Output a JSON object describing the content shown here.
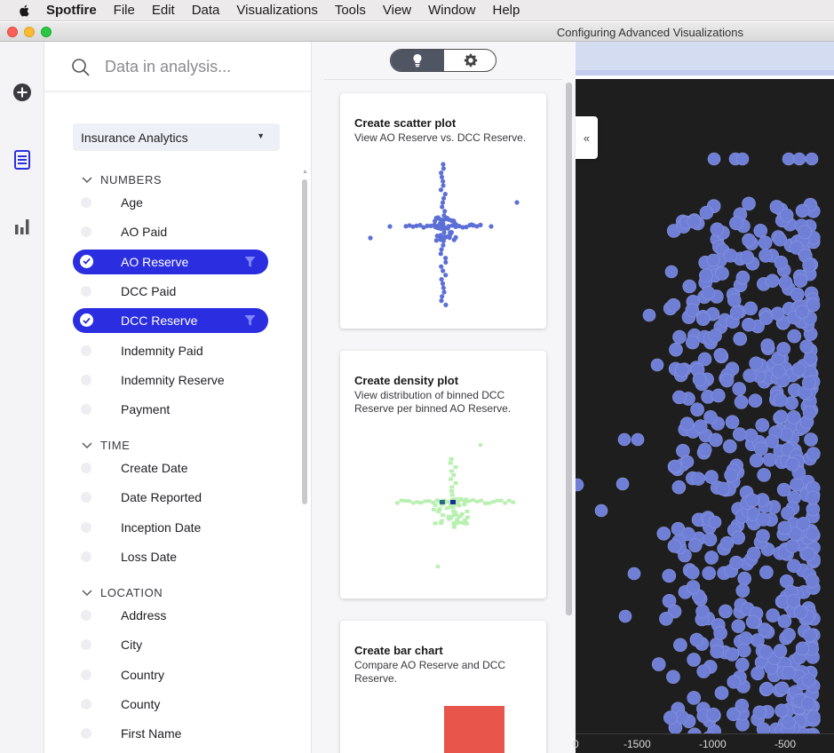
{
  "menubar": {
    "app_name": "Spotfire",
    "items": [
      "File",
      "Edit",
      "Data",
      "Visualizations",
      "Tools",
      "View",
      "Window",
      "Help"
    ]
  },
  "window": {
    "title": "Configuring Advanced Visualizations"
  },
  "rail": {
    "icons": [
      "add-icon",
      "data-panel-icon",
      "visualizations-icon"
    ]
  },
  "data_panel": {
    "search_placeholder": "Data in analysis...",
    "data_source": "Insurance Analytics",
    "sections": [
      {
        "name": "NUMBERS",
        "fields": [
          {
            "label": "Age",
            "selected": false
          },
          {
            "label": "AO Paid",
            "selected": false
          },
          {
            "label": "AO Reserve",
            "selected": true
          },
          {
            "label": "DCC Paid",
            "selected": false
          },
          {
            "label": "DCC Reserve",
            "selected": true
          },
          {
            "label": "Indemnity Paid",
            "selected": false
          },
          {
            "label": "Indemnity Reserve",
            "selected": false
          },
          {
            "label": "Payment",
            "selected": false
          }
        ]
      },
      {
        "name": "TIME",
        "fields": [
          {
            "label": "Create Date",
            "selected": false
          },
          {
            "label": "Date Reported",
            "selected": false
          },
          {
            "label": "Inception Date",
            "selected": false
          },
          {
            "label": "Loss Date",
            "selected": false
          }
        ]
      },
      {
        "name": "LOCATION",
        "fields": [
          {
            "label": "Address",
            "selected": false
          },
          {
            "label": "City",
            "selected": false
          },
          {
            "label": "Country",
            "selected": false
          },
          {
            "label": "County",
            "selected": false
          },
          {
            "label": "First Name",
            "selected": false
          }
        ]
      }
    ]
  },
  "recommendations": {
    "toggle": [
      "recommendations-lightbulb-icon",
      "settings-gear-icon"
    ],
    "active_toggle": "recommendations-lightbulb-icon",
    "cards": [
      {
        "title": "Create scatter plot",
        "description": "View AO Reserve vs. DCC Reserve.",
        "preview": "scatter"
      },
      {
        "title": "Create density plot",
        "description": "View distribution of binned DCC Reserve per binned AO Reserve.",
        "preview": "density"
      },
      {
        "title": "Create bar chart",
        "description": "Compare AO Reserve and DCC Reserve.",
        "preview": "bar"
      }
    ]
  },
  "colors": {
    "accent": "#2b2ee0",
    "scatter_point": "#5b6fd6",
    "viz_point": "#6f7fd6",
    "density_light": "#b8f0b0",
    "density_dark": "#1b2f9b",
    "bar": "#e8554a",
    "viz_background": "#1e1e1e"
  },
  "visualization": {
    "x_ticks": [
      "0",
      "-1500",
      "-1000",
      "-500"
    ]
  }
}
